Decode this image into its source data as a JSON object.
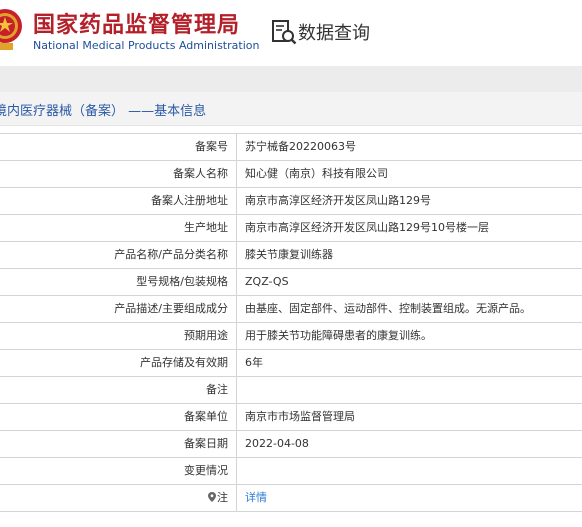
{
  "header": {
    "brand_cn": "国家药品监督管理局",
    "brand_en": "National Medical Products Administration",
    "query_title": "数据查询",
    "emblem_icon": "national-emblem-icon",
    "query_icon": "data-query-icon"
  },
  "breadcrumb": {
    "text": "境内医疗器械（备案） ——基本信息"
  },
  "record": {
    "rows": [
      {
        "label": "备案号",
        "value": "苏宁械备20220063号"
      },
      {
        "label": "备案人名称",
        "value": "知心健（南京）科技有限公司"
      },
      {
        "label": "备案人注册地址",
        "value": "南京市高淳区经济开发区凤山路129号"
      },
      {
        "label": "生产地址",
        "value": "南京市高淳区经济开发区凤山路129号10号楼一层"
      },
      {
        "label": "产品名称/产品分类名称",
        "value": "膝关节康复训练器"
      },
      {
        "label": "型号规格/包装规格",
        "value": "ZQZ-QS"
      },
      {
        "label": "产品描述/主要组成成分",
        "value": "由基座、固定部件、运动部件、控制装置组成。无源产品。"
      },
      {
        "label": "预期用途",
        "value": "用于膝关节功能障碍患者的康复训练。"
      },
      {
        "label": "产品存储及有效期",
        "value": "6年"
      },
      {
        "label": "备注",
        "value": ""
      },
      {
        "label": "备案单位",
        "value": "南京市市场监督管理局"
      },
      {
        "label": "备案日期",
        "value": "2022-04-08"
      },
      {
        "label": "变更情况",
        "value": ""
      }
    ],
    "note_row": {
      "label": "注",
      "link": "详情",
      "icon": "location-pin-icon"
    }
  },
  "colors": {
    "brand_red": "#b4202a",
    "brand_blue": "#1d4f9a",
    "link_blue": "#2b7cd3"
  }
}
